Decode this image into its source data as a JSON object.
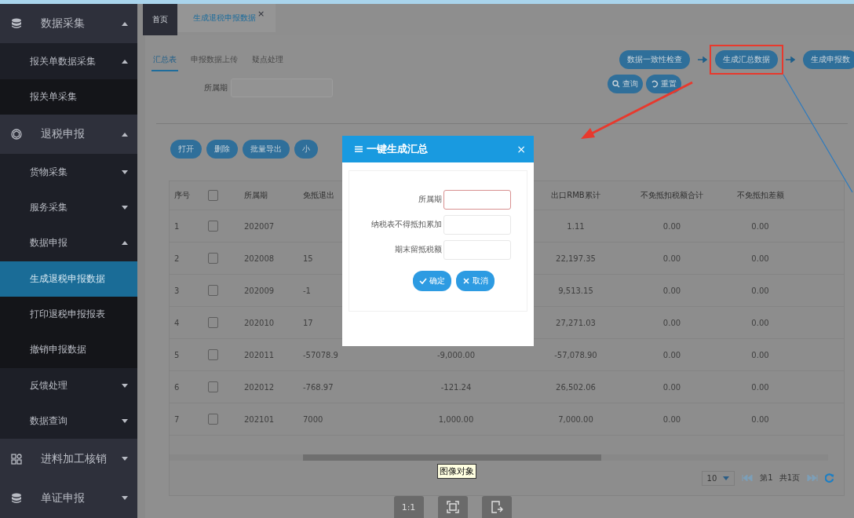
{
  "sidebar": {
    "items": [
      {
        "label": "数据采集",
        "expanded": true,
        "children": [
          {
            "label": "报关单数据采集",
            "expanded": true,
            "children": [
              {
                "label": "报关单采集",
                "selected": false
              }
            ]
          }
        ]
      },
      {
        "label": "退税申报",
        "expanded": true,
        "children": [
          {
            "label": "货物采集",
            "expanded": false
          },
          {
            "label": "服务采集",
            "expanded": false
          },
          {
            "label": "数据申报",
            "expanded": true,
            "children": [
              {
                "label": "生成退税申报数据",
                "selected": true
              },
              {
                "label": "打印退税申报报表",
                "selected": false
              },
              {
                "label": "撤销申报数据",
                "selected": false
              }
            ]
          },
          {
            "label": "反馈处理",
            "expanded": false
          },
          {
            "label": "数据查询",
            "expanded": false
          }
        ]
      },
      {
        "label": "进料加工核销",
        "expanded": false
      },
      {
        "label": "单证申报",
        "expanded": false
      }
    ]
  },
  "tabs": [
    {
      "label": "首页",
      "selected": false
    },
    {
      "label": "生成退税申报数据",
      "selected": true,
      "close": "×"
    }
  ],
  "subtabs": [
    {
      "label": "汇总表",
      "selected": true
    },
    {
      "label": "申报数据上传",
      "selected": false
    },
    {
      "label": "疑点处理",
      "selected": false
    }
  ],
  "filter": {
    "label": "所属期"
  },
  "flow_buttons": [
    {
      "label": "数据一致性检查",
      "highlighted": false
    },
    {
      "label": "生成汇总数据",
      "highlighted": true
    },
    {
      "label": "生成申报数",
      "highlighted": false
    }
  ],
  "query_buttons": [
    {
      "label": "查询",
      "kind": "search"
    },
    {
      "label": "重置",
      "kind": "reset"
    }
  ],
  "toolbar": [
    {
      "label": "打开"
    },
    {
      "label": "删除"
    },
    {
      "label": "批量导出"
    },
    {
      "label": "小"
    }
  ],
  "table": {
    "columns": [
      {
        "kind": "text",
        "label": "序号"
      },
      {
        "kind": "checkbox",
        "checked": false
      },
      {
        "kind": "text",
        "label": "所属期"
      },
      {
        "kind": "text",
        "label": "免抵退出"
      },
      {
        "kind": "hidden"
      },
      {
        "kind": "text",
        "label": "出口RMB累计"
      },
      {
        "kind": "text",
        "label": "不免抵扣税额合计"
      },
      {
        "kind": "text",
        "label": "不免抵扣差额"
      }
    ],
    "rows": [
      {
        "seq": "1",
        "checked": false,
        "period": "202007",
        "rmb": "1.11",
        "tax_total": "0.00",
        "diff": "0.00"
      },
      {
        "seq": "2",
        "checked": false,
        "period": "202008",
        "column_4": "15",
        "rmb": "22,197.35",
        "tax_total": "0.00",
        "diff": "0.00"
      },
      {
        "seq": "3",
        "checked": false,
        "period": "202009",
        "column_4": "-1",
        "rmb": "9,513.15",
        "tax_total": "0.00",
        "diff": "0.00"
      },
      {
        "seq": "4",
        "checked": false,
        "period": "202010",
        "column_4": "17",
        "rmb": "27,271.03",
        "tax_total": "0.00",
        "diff": "0.00"
      },
      {
        "seq": "5",
        "checked": false,
        "period": "202011",
        "column_4": "-57078.9",
        "column_5": "-9,000.00",
        "rmb": "-57,078.90",
        "tax_total": "0.00",
        "diff": "0.00"
      },
      {
        "seq": "6",
        "checked": false,
        "period": "202012",
        "column_4": "-768.97",
        "column_5": "-121.24",
        "rmb": "26,502.06",
        "tax_total": "0.00",
        "diff": "0.00"
      },
      {
        "seq": "7",
        "checked": false,
        "period": "202101",
        "column_4": "7000",
        "column_5": "1,000.00",
        "rmb": "7,000.00",
        "tax_total": "0.00",
        "diff": "0.00"
      }
    ]
  },
  "tooltip": "图像对象",
  "pagination": {
    "page_size": "10",
    "page": "第1",
    "total": "共1页"
  },
  "viewer_buttons": [
    {
      "kind": "actual-size",
      "label": "1:1"
    },
    {
      "kind": "fit"
    },
    {
      "kind": "export"
    }
  ],
  "dialog": {
    "title": "一键生成汇总",
    "close": "×",
    "fields": [
      {
        "label": "所属期",
        "invalid": true
      },
      {
        "label": "纳税表不得抵扣累加",
        "invalid": false
      },
      {
        "label": "期末留抵税额",
        "invalid": false
      }
    ],
    "buttons": [
      {
        "label": "确定",
        "kind": "ok"
      },
      {
        "label": "取消",
        "kind": "cancel"
      }
    ]
  }
}
